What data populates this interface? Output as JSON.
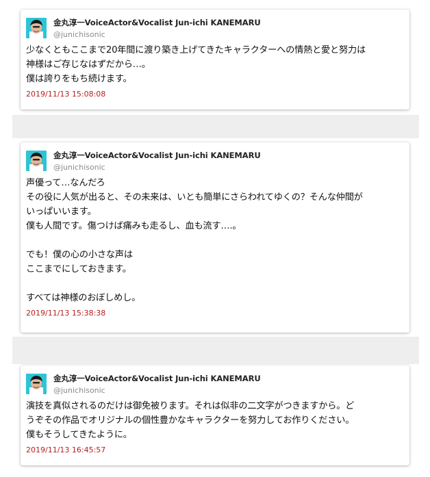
{
  "colors": {
    "page_background": "#ffffff",
    "band_background": "#eeeeee",
    "card_background": "#ffffff",
    "timestamp": "#b52020",
    "avatar_background": "#2ec4d6"
  },
  "tweets": [
    {
      "display_name": "金丸淳一VoiceActor&Vocalist Jun-ichi KANEMARU",
      "handle": "@junichisonic",
      "avatar_icon": "profile-photo",
      "lines": [
        "少なくともここまで20年間に渡り築き上げてきたキャラクターへの情熱と愛と努力は",
        "神様はご存じなはずだから…。",
        "僕は誇りをもち続けます。"
      ],
      "timestamp": "2019/11/13 15:08:08"
    },
    {
      "display_name": "金丸淳一VoiceActor&Vocalist Jun-ichi KANEMARU",
      "handle": "@junichisonic",
      "avatar_icon": "profile-photo",
      "lines": [
        "声優って…なんだろ",
        "その役に人気が出ると、その未来は、いとも簡単にさらわれてゆくの？そんな仲間が",
        "いっぱいいます。",
        "僕も人間です。傷つけば痛みも走るし、血も流す….。",
        "",
        "でも！僕の心の小さな声は",
        "ここまでにしておきます。",
        "",
        "すべては神様のおぼしめし。"
      ],
      "timestamp": "2019/11/13 15:38:38"
    },
    {
      "display_name": "金丸淳一VoiceActor&Vocalist Jun-ichi KANEMARU",
      "handle": "@junichisonic",
      "avatar_icon": "profile-photo",
      "lines": [
        "演技を真似されるのだけは御免被ります。それは似非の二文字がつきますから。ど",
        "うぞその作品でオリジナルの個性豊かなキャラクターを努力してお作りください。",
        "僕もそうしてきたように。"
      ],
      "timestamp": "2019/11/13 16:45:57"
    }
  ]
}
